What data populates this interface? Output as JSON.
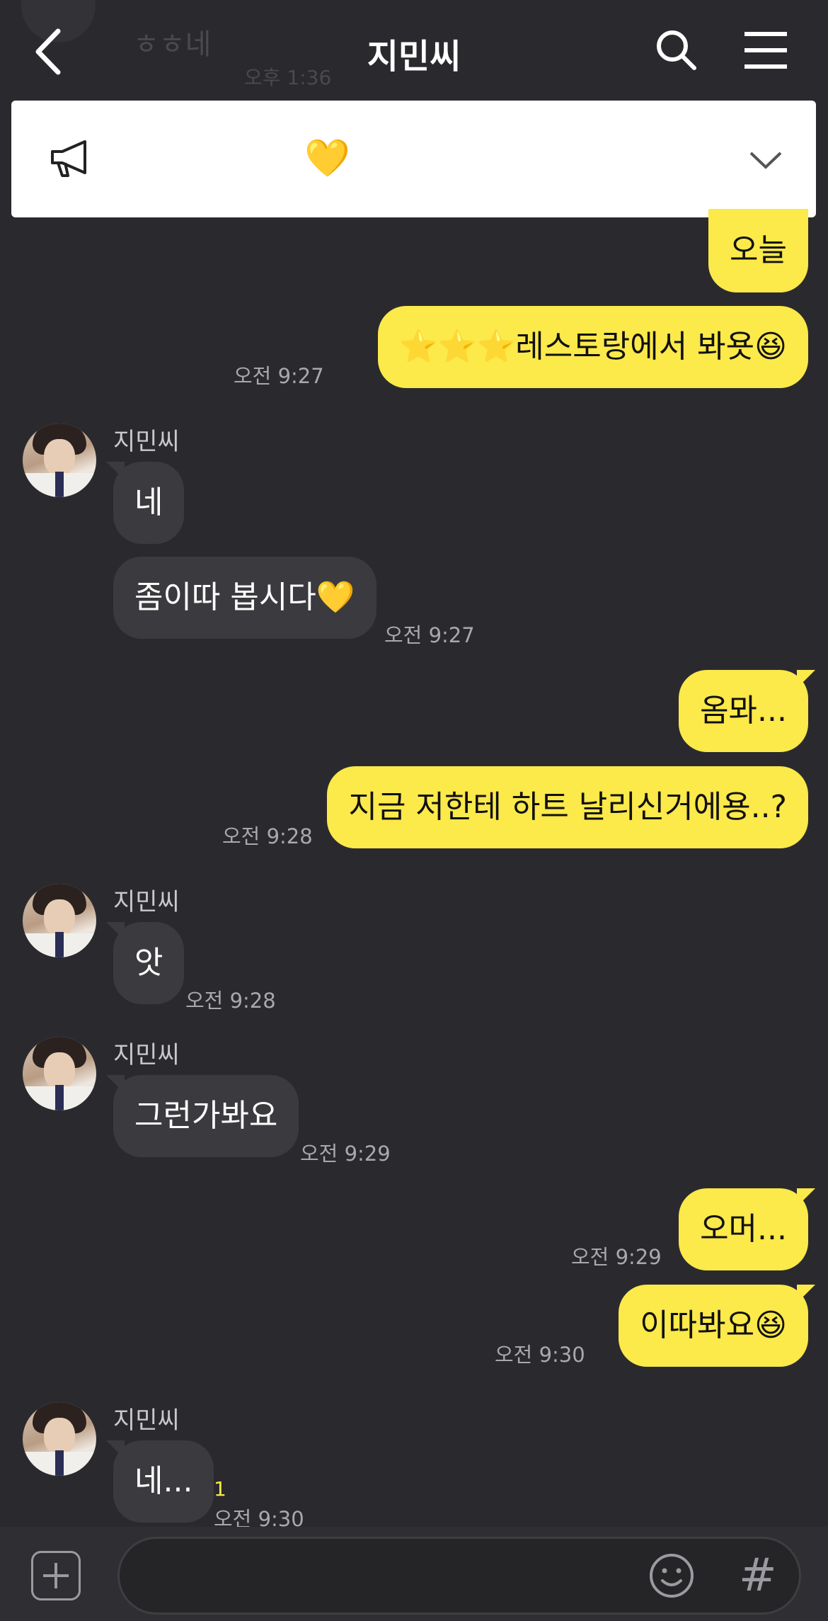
{
  "header": {
    "title": "지민씨",
    "ghost_name": "ㅎㅎ네",
    "ghost_time": "오후 1:36"
  },
  "notice": {
    "text": "💛"
  },
  "messages": {
    "m1": "오늘",
    "m2_text": "레스토랑에서 봐욧",
    "m2_stars": "⭐⭐⭐",
    "m2_emoji": "😆",
    "t1": "오전 9:27",
    "n1": "지민씨",
    "m3": "네",
    "m4_text": "좀이따 봅시다",
    "m4_emoji": "💛",
    "t2": "오전 9:27",
    "m5": "옴뫄...",
    "m6": "지금 저한테 하트 날리신거에용..?",
    "t3": "오전 9:28",
    "n2": "지민씨",
    "m7": "앗",
    "t4": "오전 9:28",
    "n3": "지민씨",
    "m8": "그런가봐요",
    "t5": "오전 9:29",
    "m9": "오머...",
    "t6": "오전 9:29",
    "m10_text": "이따봐요",
    "m10_emoji": "😆",
    "t7": "오전 9:30",
    "n4": "지민씨",
    "m11": "네...",
    "unread": "1",
    "t8": "오전 9:30"
  },
  "composer": {
    "hash": "#"
  },
  "icons": {
    "back": "chevron-left-icon",
    "search": "search-icon",
    "menu": "hamburger-menu-icon",
    "notice": "megaphone-icon",
    "expand": "chevron-down-icon",
    "attach": "plus-square-icon",
    "emoticon": "smile-icon"
  },
  "colors": {
    "background": "#2a2a2e",
    "my_bubble": "#fce94a",
    "their_bubble": "#3b3b3f"
  }
}
